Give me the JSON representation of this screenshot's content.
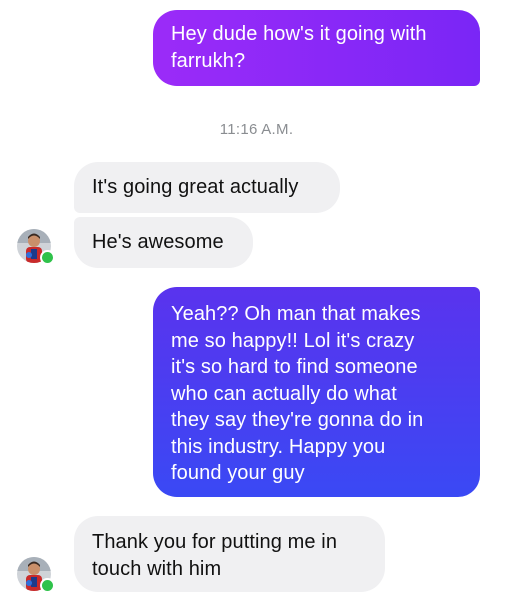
{
  "conversation": {
    "messages": [
      {
        "direction": "sent",
        "text": "Hey dude how's it going with\nfarrukh?"
      },
      {
        "direction": "timestamp",
        "text": "11:16 A.M."
      },
      {
        "direction": "received",
        "text": "It's going great actually"
      },
      {
        "direction": "received",
        "text": "He's awesome",
        "avatar": "contact-avatar",
        "online": true
      },
      {
        "direction": "sent",
        "text": "Yeah?? Oh man that makes\nme so happy!! Lol it's crazy\nit's so hard to find someone\nwho can actually do what\nthey say they're gonna do in\nthis industry. Happy you\nfound your guy"
      },
      {
        "direction": "received",
        "text": "Thank you for putting me in\ntouch with him",
        "avatar": "contact-avatar",
        "online": true
      }
    ]
  },
  "colors": {
    "sent_gradient_top": "#9b2bf8",
    "sent_gradient_bottom": "#3a49f4",
    "received_bg": "#f0f0f2",
    "presence_green": "#2fc24a",
    "timestamp_gray": "#8a8d91"
  }
}
